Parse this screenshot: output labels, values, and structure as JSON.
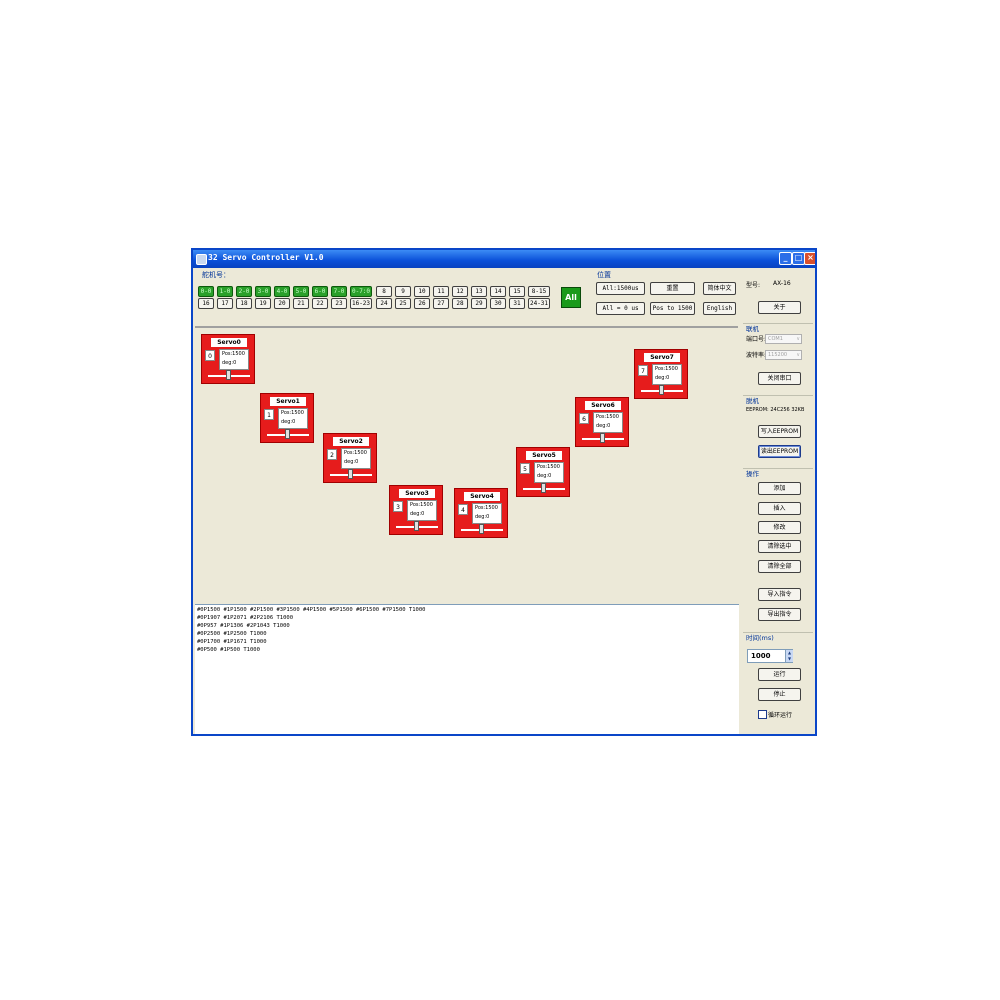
{
  "window": {
    "title": "32 Servo Controller V1.0"
  },
  "channel_group": {
    "label": "舵机号：",
    "row1": [
      {
        "label": "0-0",
        "active": true
      },
      {
        "label": "1-0",
        "active": true
      },
      {
        "label": "2-0",
        "active": true
      },
      {
        "label": "3-0",
        "active": true
      },
      {
        "label": "4-0",
        "active": true
      },
      {
        "label": "5-0",
        "active": true
      },
      {
        "label": "6-0",
        "active": true
      },
      {
        "label": "7-0",
        "active": true
      },
      {
        "label": "0-7:0",
        "active": true
      },
      {
        "label": "8"
      },
      {
        "label": "9"
      },
      {
        "label": "10"
      },
      {
        "label": "11"
      },
      {
        "label": "12"
      },
      {
        "label": "13"
      },
      {
        "label": "14"
      },
      {
        "label": "15"
      },
      {
        "label": "8-15"
      }
    ],
    "row2": [
      {
        "label": "16"
      },
      {
        "label": "17"
      },
      {
        "label": "18"
      },
      {
        "label": "19"
      },
      {
        "label": "20"
      },
      {
        "label": "21"
      },
      {
        "label": "22"
      },
      {
        "label": "23"
      },
      {
        "label": "16-23"
      },
      {
        "label": "24"
      },
      {
        "label": "25"
      },
      {
        "label": "26"
      },
      {
        "label": "27"
      },
      {
        "label": "28"
      },
      {
        "label": "29"
      },
      {
        "label": "30"
      },
      {
        "label": "31"
      },
      {
        "label": "24-31"
      }
    ],
    "all_label": "All"
  },
  "position_group": {
    "label": "位置",
    "all_1500": "All:1500us",
    "reset": "重置",
    "all_0": "All = 0 us",
    "pos_1500": "Pos to 1500",
    "chinese": "简体中文",
    "english": "English"
  },
  "servos": [
    {
      "name": "Servo0",
      "num": "0",
      "pos": "Pos:1500",
      "deg": "deg:0"
    },
    {
      "name": "Servo1",
      "num": "1",
      "pos": "Pos:1500",
      "deg": "deg:0"
    },
    {
      "name": "Servo2",
      "num": "2",
      "pos": "Pos:1500",
      "deg": "deg:0"
    },
    {
      "name": "Servo3",
      "num": "3",
      "pos": "Pos:1500",
      "deg": "deg:0"
    },
    {
      "name": "Servo4",
      "num": "4",
      "pos": "Pos:1500",
      "deg": "deg:0"
    },
    {
      "name": "Servo5",
      "num": "5",
      "pos": "Pos:1500",
      "deg": "deg:0"
    },
    {
      "name": "Servo6",
      "num": "6",
      "pos": "Pos:1500",
      "deg": "deg:0"
    },
    {
      "name": "Servo7",
      "num": "7",
      "pos": "Pos:1500",
      "deg": "deg:0"
    }
  ],
  "commands": [
    "#0P1500 #1P1500 #2P1500 #3P1500 #4P1500 #5P1500 #6P1500 #7P1500 T1000",
    "#0P1907 #1P2071 #2P2106 T1000",
    "#0P957 #1P1306 #2P1043 T1000",
    "#0P2500 #1P2500 T1000",
    "#0P1700 #1P1671 T1000",
    "#0P500 #1P500 T1000"
  ],
  "right_panel": {
    "model_label": "型号:",
    "model_value": "AX-16",
    "about": "关于",
    "port_group": "联机",
    "port_label": "端口号:",
    "port_value": "COM1",
    "baud_label": "波特率:",
    "baud_value": "115200",
    "close_port": "关闭串口",
    "device_group": "脱机",
    "eeprom_info": "EEPROM: 24C256 32KB",
    "write_eeprom": "写入EEPROM",
    "read_eeprom": "读出EEPROM",
    "ops_group": "操作",
    "add": "添加",
    "insert": "插入",
    "modify": "修改",
    "clear_selected": "清除选中",
    "clear_all": "清除全部",
    "import_cmd": "导入指令",
    "export_cmd": "导出指令",
    "time_group": "时间(ms)",
    "time_value": "1000",
    "run": "运行",
    "stop": "停止",
    "loop_run": "循环运行"
  }
}
